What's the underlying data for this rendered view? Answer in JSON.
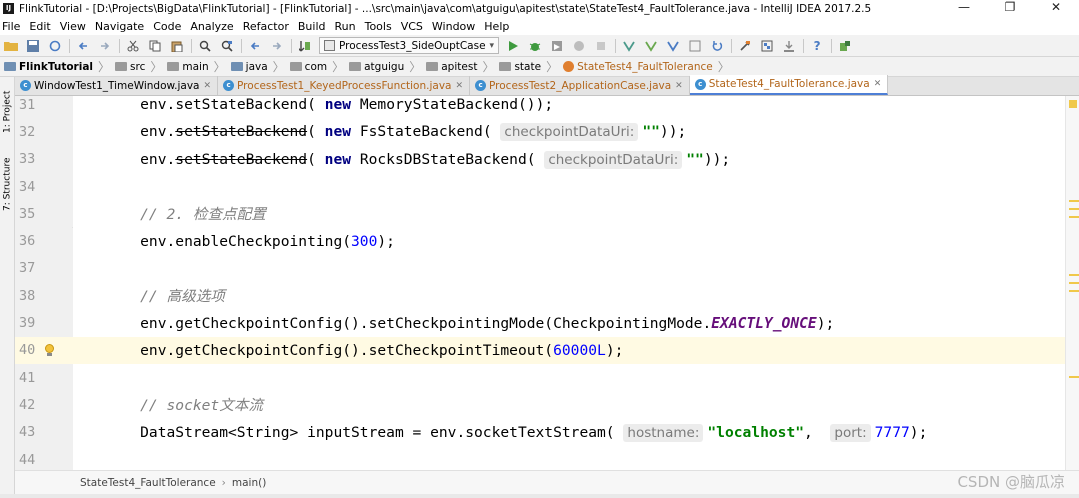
{
  "window": {
    "title": "FlinkTutorial - [D:\\Projects\\BigData\\FlinkTutorial] - [FlinkTutorial] - ...\\src\\main\\java\\com\\atguigu\\apitest\\state\\StateTest4_FaultTolerance.java - IntelliJ IDEA 2017.2.5",
    "minimize": "—",
    "restore": "❐",
    "close": "✕"
  },
  "menu": [
    "File",
    "Edit",
    "View",
    "Navigate",
    "Code",
    "Analyze",
    "Refactor",
    "Build",
    "Run",
    "Tools",
    "VCS",
    "Window",
    "Help"
  ],
  "toolbar": {
    "run_config": "ProcessTest3_SideOuptCase"
  },
  "breadcrumbs": [
    "FlinkTutorial",
    "src",
    "main",
    "java",
    "com",
    "atguigu",
    "apitest",
    "state",
    "StateTest4_FaultTolerance"
  ],
  "side_tabs": {
    "project": "1: Project",
    "structure": "7: Structure"
  },
  "tabs": [
    {
      "label": "WindowTest1_TimeWindow.java",
      "state": "normal"
    },
    {
      "label": "ProcessTest1_KeyedProcessFunction.java",
      "state": "changed"
    },
    {
      "label": "ProcessTest2_ApplicationCase.java",
      "state": "changed"
    },
    {
      "label": "StateTest4_FaultTolerance.java",
      "state": "active"
    }
  ],
  "editor": {
    "current_line": "40",
    "lines": [
      {
        "n": "31",
        "code": "env.setStateBackend( new MemoryStateBackend());"
      },
      {
        "n": "32",
        "code": "env.setStateBackend( new FsStateBackend( checkpointDataUri: \"\"));"
      },
      {
        "n": "33",
        "code": "env.setStateBackend( new RocksDBStateBackend( checkpointDataUri: \"\"));"
      },
      {
        "n": "34",
        "code": ""
      },
      {
        "n": "35",
        "code": "// 2. 检查点配置"
      },
      {
        "n": "36",
        "code": "env.enableCheckpointing(300);"
      },
      {
        "n": "37",
        "code": ""
      },
      {
        "n": "38",
        "code": "// 高级选项"
      },
      {
        "n": "39",
        "code": "env.getCheckpointConfig().setCheckpointingMode(CheckpointingMode.EXACTLY_ONCE);"
      },
      {
        "n": "40",
        "code": "env.getCheckpointConfig().setCheckpointTimeout(60000L);"
      },
      {
        "n": "41",
        "code": ""
      },
      {
        "n": "42",
        "code": "// socket文本流"
      },
      {
        "n": "43",
        "code": "DataStream<String> inputStream = env.socketTextStream( hostname: \"localhost\",  port: 7777);"
      },
      {
        "n": "44",
        "code": ""
      }
    ]
  },
  "footer": {
    "class_crumb": "StateTest4_FaultTolerance",
    "method_crumb": "main()"
  },
  "watermark": "CSDN @脑瓜凉",
  "colors": {
    "keyword": "#000080",
    "number": "#0000ff",
    "string": "#008000",
    "comment": "#808080",
    "static_field": "#660e7a",
    "current_line_bg": "#fffae3",
    "active_tab_underline": "#4e7fd6"
  }
}
